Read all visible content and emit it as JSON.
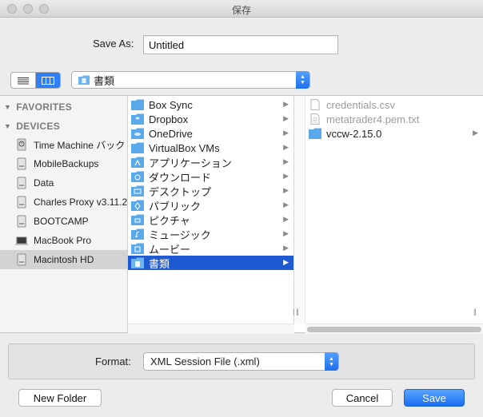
{
  "window": {
    "title": "保存"
  },
  "save_as": {
    "label": "Save As:",
    "value": "Untitled"
  },
  "location": {
    "label": "書類"
  },
  "sidebar": {
    "sections": [
      {
        "label": "FAVORITES"
      },
      {
        "label": "DEVICES"
      }
    ],
    "devices": [
      {
        "label": "Time Machine バック",
        "icon": "time-machine-drive-icon"
      },
      {
        "label": "MobileBackups",
        "icon": "disk-icon"
      },
      {
        "label": "Data",
        "icon": "disk-icon"
      },
      {
        "label": "Charles Proxy v3.11.2",
        "icon": "disk-icon"
      },
      {
        "label": "BOOTCAMP",
        "icon": "disk-icon"
      },
      {
        "label": "MacBook Pro",
        "icon": "laptop-icon"
      },
      {
        "label": "Macintosh HD",
        "icon": "disk-icon",
        "selected": true
      }
    ]
  },
  "column1": [
    {
      "label": "Box Sync",
      "icon": "folder-icon"
    },
    {
      "label": "Dropbox",
      "icon": "dropbox-folder-icon"
    },
    {
      "label": "OneDrive",
      "icon": "cloud-folder-icon"
    },
    {
      "label": "VirtualBox VMs",
      "icon": "folder-icon"
    },
    {
      "label": "アプリケーション",
      "icon": "applications-folder-icon"
    },
    {
      "label": "ダウンロード",
      "icon": "downloads-folder-icon"
    },
    {
      "label": "デスクトップ",
      "icon": "desktop-folder-icon"
    },
    {
      "label": "パブリック",
      "icon": "public-folder-icon"
    },
    {
      "label": "ピクチャ",
      "icon": "pictures-folder-icon"
    },
    {
      "label": "ミュージック",
      "icon": "music-folder-icon"
    },
    {
      "label": "ムービー",
      "icon": "movies-folder-icon"
    },
    {
      "label": "書類",
      "icon": "documents-folder-icon",
      "selected": true
    }
  ],
  "column2": [
    {
      "label": "credentials.csv",
      "icon": "document-icon",
      "disabled": true
    },
    {
      "label": "metatrader4.pem.txt",
      "icon": "document-icon",
      "disabled": true
    },
    {
      "label": "vccw-2.15.0",
      "icon": "folder-icon",
      "disabled": false
    }
  ],
  "format": {
    "label": "Format:",
    "value": "XML Session File (.xml)"
  },
  "buttons": {
    "new_folder": "New Folder",
    "cancel": "Cancel",
    "save": "Save"
  },
  "colors": {
    "accent": "#1e5bd3",
    "folder": "#5aa9ea",
    "button_primary": "#1a6ef0"
  }
}
